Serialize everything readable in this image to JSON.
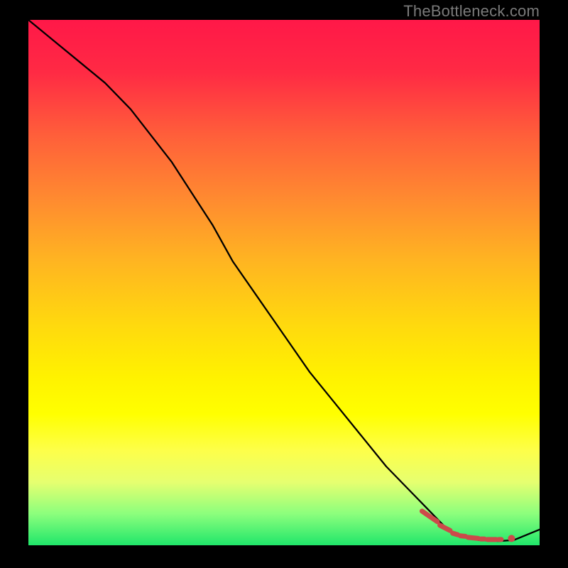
{
  "watermark": "TheBottleneck.com",
  "colors": {
    "line": "#000000",
    "marker": "#cc4a4a",
    "bg_top": "#ff1848",
    "bg_mid": "#ffff00",
    "bg_bottom": "#20e66a"
  },
  "chart_data": {
    "type": "line",
    "title": "",
    "xlabel": "",
    "ylabel": "",
    "xlim": [
      0,
      100
    ],
    "ylim": [
      0,
      100
    ],
    "grid": false,
    "legend": false,
    "series": [
      {
        "name": "curve",
        "x": [
          0,
          5,
          10,
          15,
          20,
          24,
          28,
          32,
          36,
          40,
          45,
          50,
          55,
          60,
          65,
          70,
          75,
          78,
          80,
          82,
          84,
          86,
          88,
          90,
          92,
          95,
          100
        ],
        "y": [
          100,
          96,
          92,
          88,
          83,
          78,
          73,
          67,
          61,
          54,
          47,
          40,
          33,
          27,
          21,
          15,
          10,
          7,
          5,
          3,
          2,
          1.4,
          1.0,
          0.9,
          0.8,
          1.0,
          3
        ]
      }
    ],
    "markers": [
      {
        "name": "dash-1",
        "shape": "segment",
        "x": [
          77,
          80
        ],
        "y": [
          6.5,
          4.5
        ]
      },
      {
        "name": "dash-2",
        "shape": "segment",
        "x": [
          80.5,
          82.5
        ],
        "y": [
          3.8,
          2.8
        ]
      },
      {
        "name": "dash-3",
        "shape": "segment",
        "x": [
          83,
          84
        ],
        "y": [
          2.3,
          2.0
        ]
      },
      {
        "name": "dash-4",
        "shape": "segment",
        "x": [
          84.5,
          85.5
        ],
        "y": [
          1.8,
          1.7
        ]
      },
      {
        "name": "dash-5",
        "shape": "segment",
        "x": [
          86,
          88
        ],
        "y": [
          1.5,
          1.3
        ]
      },
      {
        "name": "dash-6",
        "shape": "segment",
        "x": [
          88.5,
          89.2
        ],
        "y": [
          1.2,
          1.2
        ]
      },
      {
        "name": "dash-7",
        "shape": "segment",
        "x": [
          89.8,
          91.5
        ],
        "y": [
          1.1,
          1.1
        ]
      },
      {
        "name": "dash-8",
        "shape": "segment",
        "x": [
          92,
          92.5
        ],
        "y": [
          1.1,
          1.1
        ]
      },
      {
        "name": "dot-end",
        "shape": "circle",
        "x": 94.5,
        "y": 1.3,
        "r": 0.7
      }
    ]
  }
}
